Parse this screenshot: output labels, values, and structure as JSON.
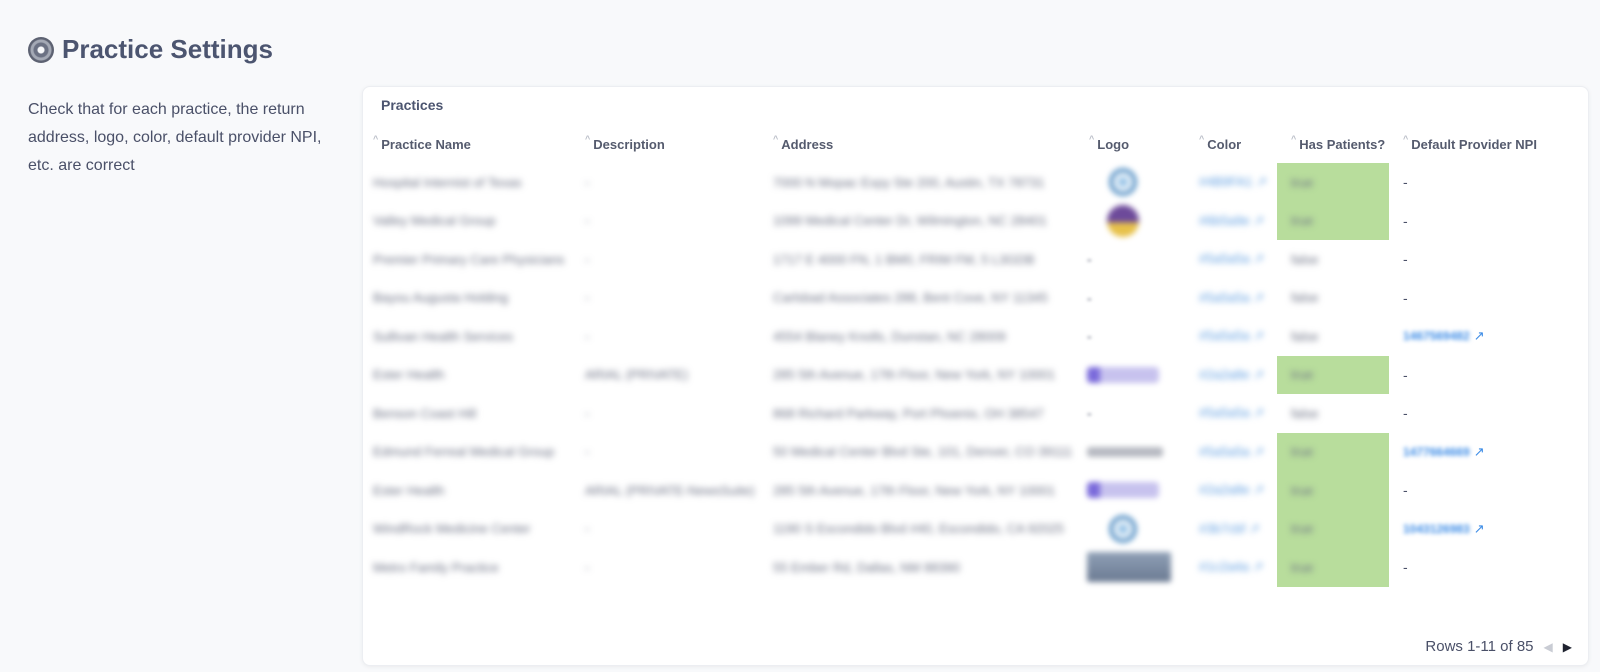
{
  "page": {
    "title": "Practice Settings",
    "description": "Check that for each practice, the return address, logo, color, default provider NPI, etc. are correct"
  },
  "card": {
    "title": "Practices",
    "columns": [
      "Practice Name",
      "Description",
      "Address",
      "Logo",
      "Color",
      "Has Patients?",
      "Default Provider NPI"
    ],
    "rows": [
      {
        "name": "Hospital Internist of Texas",
        "description": "-",
        "address": "7000 N Mopac Expy Ste 200, Austin, TX 78731",
        "logo": "blue-emblem",
        "color": "#4B9FA1",
        "has_patients": "true",
        "npi": "-",
        "npi_link": false
      },
      {
        "name": "Valley Medical Group",
        "description": "-",
        "address": "1099 Medical Center Dr, Wilmington, NC 28401",
        "logo": "purple-seal",
        "color": "#6b5a9e",
        "has_patients": "true",
        "npi": "-",
        "npi_link": false
      },
      {
        "name": "Premier Primary Care Physicians",
        "description": "-",
        "address": "1717 E 4000 FN, 1 BM0, FRIM FM, 5 L3GDB",
        "logo": "-",
        "color": "#5a5a5a",
        "has_patients": "false",
        "npi": "-",
        "npi_link": false
      },
      {
        "name": "Bayou Augusta Holding",
        "description": "-",
        "address": "Carlsbad Associates 288, Bent Cove, NY 11345",
        "logo": "-",
        "color": "#5a5a5a",
        "has_patients": "false",
        "npi": "-",
        "npi_link": false
      },
      {
        "name": "Sullivan Health Services",
        "description": "-",
        "address": "4554 Blaney Knolls, Dunstan, NC 28009",
        "logo": "-",
        "color": "#5a5a5a",
        "has_patients": "false",
        "npi": "1467569482",
        "npi_link": true
      },
      {
        "name": "Ester Health",
        "description": "ARIAL (PRIVATE)",
        "address": "285 5th Avenue, 17th Floor, New York, NY 10001",
        "logo": "purple-wordmark",
        "color": "#2a2a8e",
        "has_patients": "true",
        "npi": "-",
        "npi_link": false
      },
      {
        "name": "Benson Coast Hill",
        "description": "-",
        "address": "868 Richard Parkway, Port Phoenix, OH 38547",
        "logo": "-",
        "color": "#5a5a5a",
        "has_patients": "false",
        "npi": "-",
        "npi_link": false
      },
      {
        "name": "Edmund Ferreal Medical Group",
        "description": "-",
        "address": "50 Medical Center Blvd Ste, 101, Denver, CO 39111",
        "logo": "gray-wordmark",
        "color": "#5a5a5a",
        "has_patients": "true",
        "npi": "1477664669",
        "npi_link": true
      },
      {
        "name": "Ester Health",
        "description": "ARIAL (PRIVATE-NewsSuite)",
        "address": "285 5th Avenue, 17th Floor, New York, NY 10001",
        "logo": "purple-wordmark",
        "color": "#2a2a8e",
        "has_patients": "true",
        "npi": "-",
        "npi_link": false
      },
      {
        "name": "WindRock Medicine Center",
        "description": "-",
        "address": "1190 S Escondido Blvd #40, Escondido, CA 92025",
        "logo": "blue-emblem",
        "color": "#3b7cbf",
        "has_patients": "true",
        "npi": "1043126983",
        "npi_link": true
      },
      {
        "name": "Metro Family Practice",
        "description": "-",
        "address": "55 Ember Rd, Dallas, NM 88390",
        "logo": "gray-block",
        "color": "#1c2a4a",
        "has_patients": "true",
        "npi": "-",
        "npi_link": false
      }
    ],
    "footer": {
      "rows_label": "Rows 1-11 of 85",
      "prev_icon": "chevron-left-icon",
      "next_icon": "chevron-right-icon"
    }
  }
}
